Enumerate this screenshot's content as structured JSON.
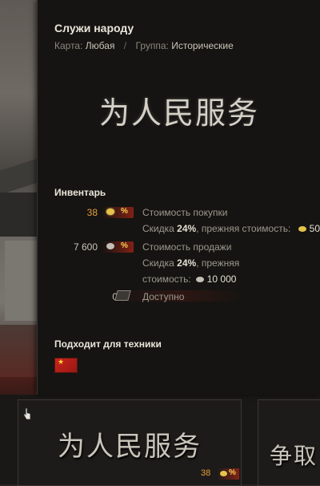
{
  "tooltip": {
    "title": "Служи народу",
    "map_label": "Карта:",
    "map_value": "Любая",
    "separator": "/",
    "group_label": "Группа:",
    "group_value": "Исторические",
    "emblem_text": "为人民服务",
    "inventory": {
      "title": "Инвентарь",
      "buy": {
        "amount": "38",
        "currency_icon": "gold-coin-icon",
        "badge": "%",
        "label": "Стоимость покупки",
        "discount_prefix": "Скидка",
        "discount_value": "24%",
        "discount_suffix": ", прежняя стоимость:",
        "old_price": "50"
      },
      "sell": {
        "amount": "7 600",
        "currency_icon": "silver-coin-icon",
        "badge": "%",
        "label": "Стоимость продажи",
        "discount_prefix": "Скидка",
        "discount_value": "24%",
        "discount_suffix": ", прежняя",
        "line2_prefix": "стоимость:",
        "old_price": "10 000"
      },
      "available": {
        "amount": "0",
        "label": "Доступно"
      }
    },
    "vehicles": {
      "title": "Подходит для техники",
      "flag": "china-flag-icon"
    }
  },
  "carousel": {
    "slot1_text": "为人民服务",
    "slot1_price": "38",
    "slot1_badge": "%",
    "slot2_text": "争取"
  },
  "colors": {
    "gold": "#e89e3c",
    "discount_badge": "#962314",
    "panel_bg": "#151412"
  }
}
